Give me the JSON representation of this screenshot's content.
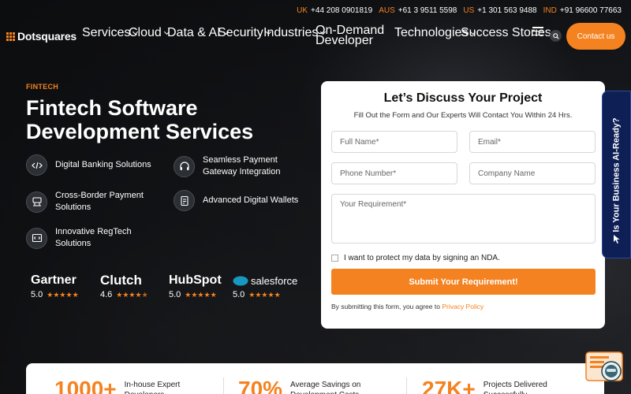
{
  "phones": [
    {
      "country": "UK",
      "number": "+44 208 0901819"
    },
    {
      "country": "AUS",
      "number": "+61 3 9511 5598"
    },
    {
      "country": "US",
      "number": "+1 301 563 9488"
    },
    {
      "country": "IND",
      "number": "+91 96600 77663"
    }
  ],
  "brand": {
    "name": "Dotsquares",
    "accent": "#f58220"
  },
  "nav": {
    "services": "Services",
    "cloud": "Cloud",
    "data_ai": "Data & AI",
    "security": "Security",
    "industries": "Industries",
    "on_demand_1": "On-Demand",
    "on_demand_2": "Developer",
    "technologies": "Technologies",
    "success": "Success Stories",
    "contact": "Contact us"
  },
  "hero": {
    "eyebrow": "FINTECH",
    "title": "Fintech Software Development Services",
    "features": [
      {
        "icon": "code-icon",
        "label": "Digital Banking Solutions"
      },
      {
        "icon": "headset-icon",
        "label": "Seamless Payment Gateway Integration"
      },
      {
        "icon": "network-icon",
        "label": "Cross-Border Payment Solutions"
      },
      {
        "icon": "wallet-icon",
        "label": "Advanced Digital Wallets"
      },
      {
        "icon": "regtech-icon",
        "label": "Innovative RegTech Solutions"
      }
    ]
  },
  "ratings": [
    {
      "name": "Gartner",
      "score": "5.0",
      "stars": 5
    },
    {
      "name": "Clutch",
      "score": "4.6",
      "stars": 4.6
    },
    {
      "name": "HubSpot",
      "score": "5.0",
      "stars": 5
    },
    {
      "name": "salesforce",
      "score": "5.0",
      "stars": 5
    }
  ],
  "form": {
    "title": "Let’s Discuss Your Project",
    "subtitle": "Fill Out the Form and Our Experts Will Contact You Within 24 Hrs.",
    "full_name": "Full Name*",
    "email": "Email*",
    "phone": "Phone Number*",
    "company": "Company Name",
    "requirement": "Your Requirement*",
    "nda": "I want to protect my data by signing an NDA.",
    "submit": "Submit Your Requirement!",
    "agree_prefix": "By submitting this form, you agree to",
    "privacy": "Privacy Policy"
  },
  "side_tab": "Is Your Business AI-Ready?",
  "stats": [
    {
      "number": "1000+",
      "label": "In-house Expert Developers"
    },
    {
      "number": "70%",
      "label": "Average Savings on Development Costs"
    },
    {
      "number": "27K+",
      "label": "Projects Delivered Successfully"
    }
  ]
}
